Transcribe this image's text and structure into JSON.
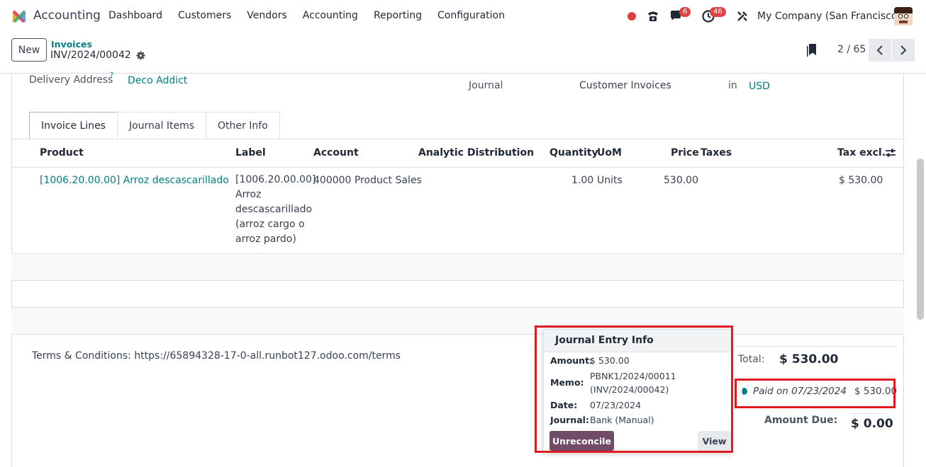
{
  "nav": {
    "app_name": "Accounting",
    "menu": [
      "Dashboard",
      "Customers",
      "Vendors",
      "Accounting",
      "Reporting",
      "Configuration"
    ],
    "messages_badge": "6",
    "activities_badge": "46",
    "company": "My Company (San Francisco)"
  },
  "control": {
    "new_label": "New",
    "breadcrumb_parent": "Invoices",
    "breadcrumb_current": "INV/2024/00042",
    "pager": "2 / 65"
  },
  "form": {
    "delivery_label": "Delivery Address",
    "delivery_help": "?",
    "delivery_value": "Deco Addict",
    "journal_label": "Journal",
    "journal_value": "Customer Invoices",
    "journal_in": "in",
    "currency": "USD"
  },
  "tabs": [
    "Invoice Lines",
    "Journal Items",
    "Other Info"
  ],
  "table": {
    "headers": [
      "Product",
      "Label",
      "Account",
      "Analytic Distribution",
      "Quantity",
      "UoM",
      "Price",
      "Taxes",
      "Tax excl."
    ],
    "row": {
      "product": "[1006.20.00.00] Arroz descascarillado (arroz",
      "label_lines": [
        "[1006.20.00.00]",
        "Arroz",
        "descascarillado",
        "(arroz cargo o",
        "arroz pardo)"
      ],
      "account": "400000 Product Sales",
      "quantity": "1.00",
      "uom": "Units",
      "price": "530.00",
      "subtotal": "$ 530.00"
    }
  },
  "terms": "Terms & Conditions: https://65894328-17-0-all.runbot127.odoo.com/terms",
  "totals": {
    "total_label": "Total:",
    "total_value": "$ 530.00",
    "paid_text": "Paid on 07/23/2024",
    "paid_amount": "$ 530.00",
    "due_label": "Amount Due:",
    "due_value": "$ 0.00"
  },
  "popover": {
    "title": "Journal Entry Info",
    "amount_label": "Amount:",
    "amount_value": "$ 530.00",
    "memo_label": "Memo:",
    "memo_line1": "PBNK1/2024/00011",
    "memo_line2": "(INV/2024/00042)",
    "date_label": "Date:",
    "date_value": "07/23/2024",
    "journal_label": "Journal:",
    "journal_value": "Bank (Manual)",
    "unreconcile_label": "Unreconcile",
    "view_label": "View"
  },
  "colors": {
    "brand": "#714b67",
    "link": "#017e84",
    "highlight": "#e11b22"
  }
}
